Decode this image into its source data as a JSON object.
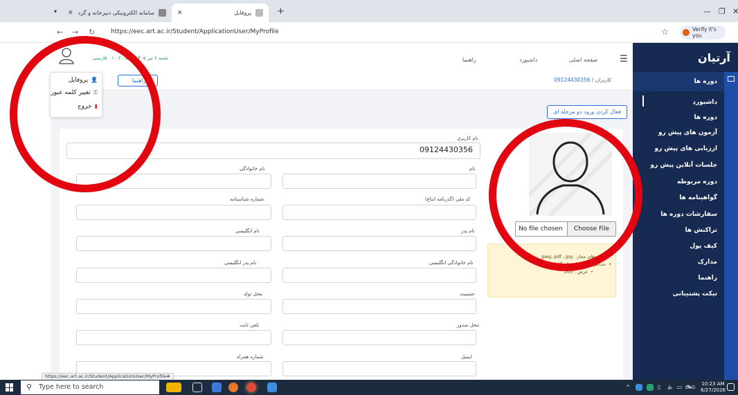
{
  "browser": {
    "tab1_title": "سامانه الکترونیکی دبیرخانه و گردش مکاتبات",
    "tab2_title": "پروفایل",
    "url": "https://eec.art.ac.ir/Student/ApplicationUser/MyProfile",
    "verify_label": "Verify it's you",
    "status_url": "https://eec.art.ac.ir/Student/ApplicationUser/MyProfile#"
  },
  "header": {
    "nav_home": "صفحه اصلی",
    "nav_dashboard": "داشبورد",
    "nav_guide": "راهنما",
    "datetime": "شنبه ۶ تیر ۱۴۰۵ - ۱۰:۲۰:۵۰",
    "language": "فارسی"
  },
  "breadcrumb": {
    "root": "کاربران",
    "current": "09124430356"
  },
  "guide_button": "راهنما",
  "dropdown": {
    "profile": "پروفایل",
    "change_password": "تغییر کلمه عبور",
    "logout": "خروج"
  },
  "tfa_button": "فعال کردن ورود دو مرحله ای",
  "sidebar": {
    "logo": "آرتیان",
    "section": "دوره ها",
    "items": [
      "داشبورد",
      "دوره ها",
      "آزمون های پیش رو",
      "ارزیابی های پیش رو",
      "جلسات آنلاین پیش رو",
      "دوره مربوطه",
      "گواهینامه ها",
      "سفارشات دوره ها",
      "تراکنش ها",
      "کیف پول",
      "مدارک",
      "راهنما",
      "تیکت پشتیبانی"
    ]
  },
  "form": {
    "username_label": "نام کاربری",
    "username_value": "09124430356",
    "first_name": "نام",
    "last_name": "نام خانوادگی",
    "national_code": "کد ملی (گذرنامه اتباع)",
    "id_number": "شماره شناسنامه",
    "father_name": "نام پدر",
    "english_name": "نام انگلیسی",
    "english_last_name": "نام خانوادگی انگلیسی",
    "english_father_name": "نام پدر انگلیسی",
    "gender": "جنسیت",
    "birth_place": "محل تولد",
    "issue_place": "محل صدور",
    "phone": "تلفن ثابت",
    "email": "ایمیل",
    "mobile": "شماره همراه"
  },
  "upload": {
    "choose_file": "Choose File",
    "no_file": "No file chosen",
    "hint1": "پسوندهای مجاز: .jpeg,.pdf ,.jpg",
    "hint2": "حداکثر حجم فایل : 1 مگا بایت",
    "hint3": "عرض : 200"
  },
  "taskbar": {
    "search_placeholder": "Type here to search",
    "lang": "ENG",
    "time": "10:23 AM",
    "date": "6/27/2026"
  }
}
